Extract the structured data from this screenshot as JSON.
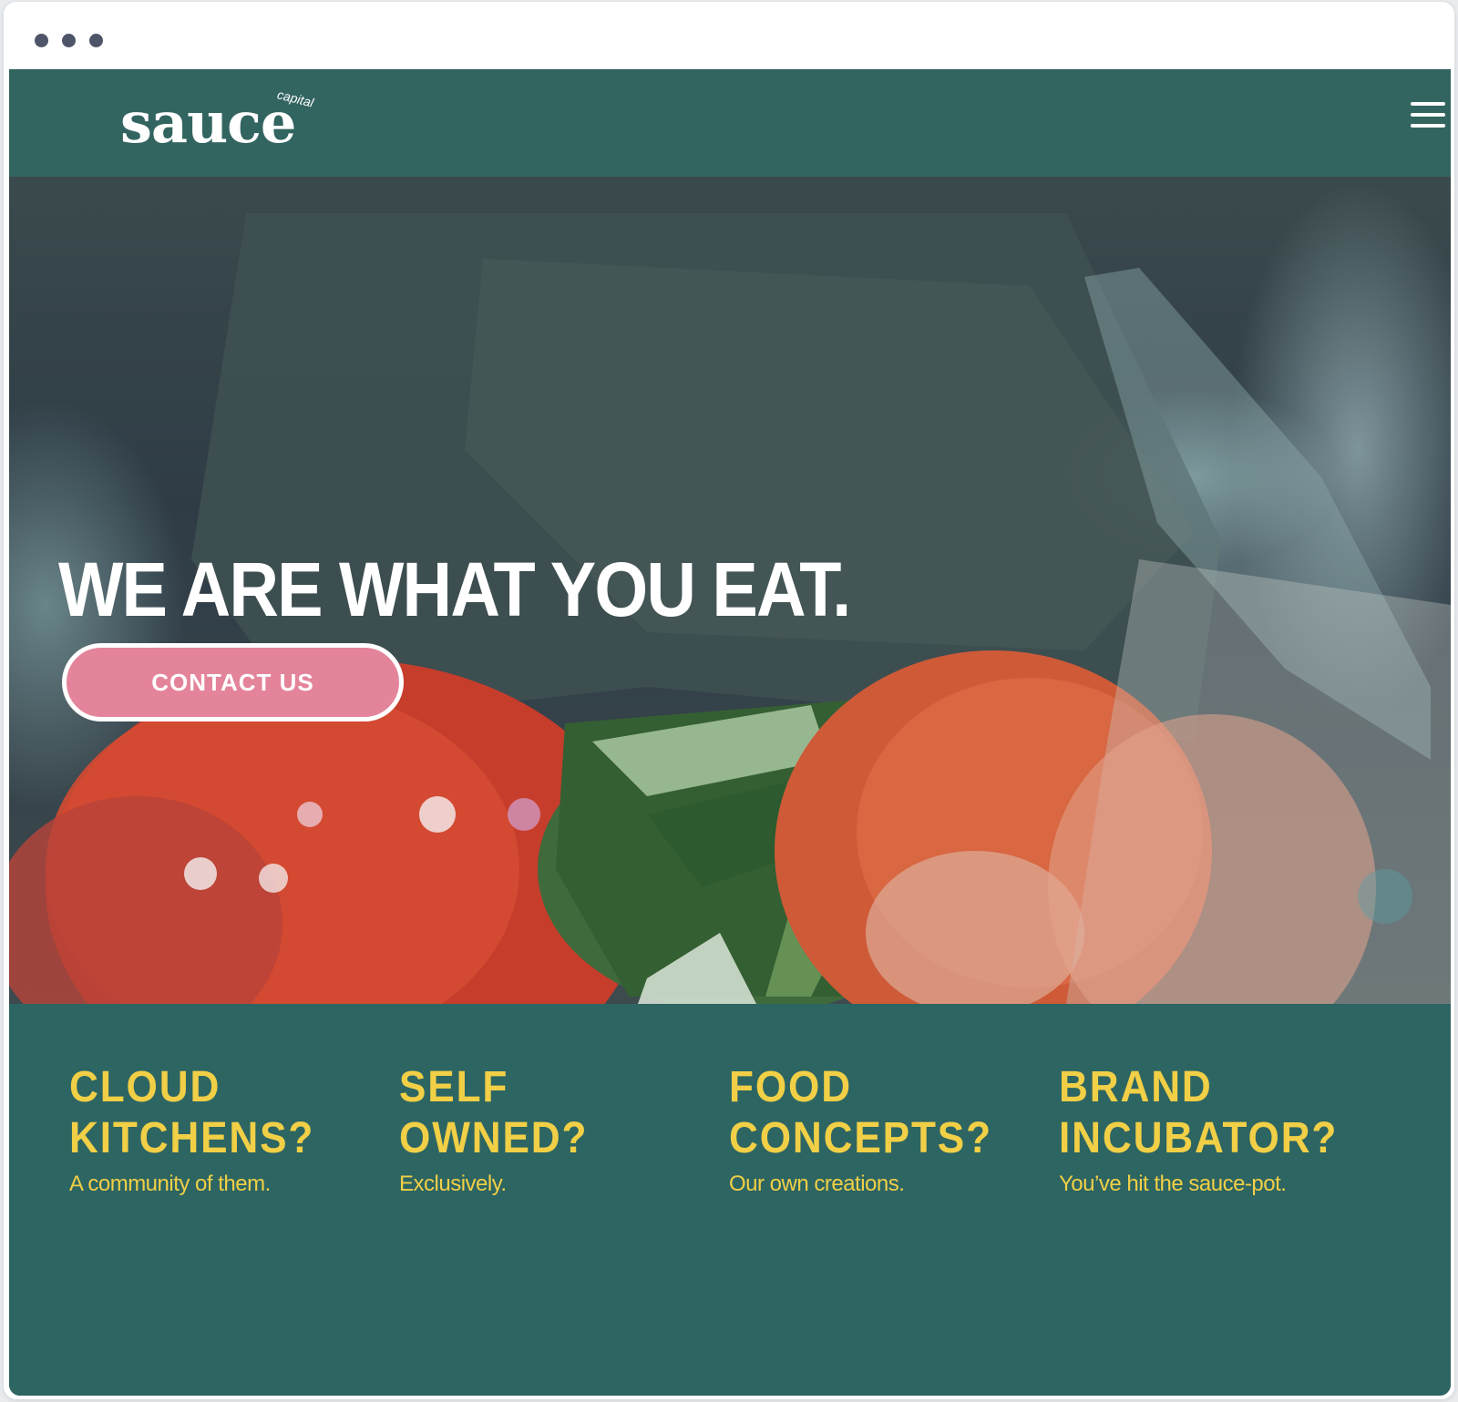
{
  "browser": {
    "window_controls": [
      "dot",
      "dot",
      "dot"
    ]
  },
  "header": {
    "logo_word": "sauce",
    "logo_sub": "capital",
    "menu_icon": "hamburger-menu-icon"
  },
  "hero": {
    "title": "WE ARE WHAT YOU EAT.",
    "cta_label": "CONTACT US"
  },
  "features": [
    {
      "line1": "CLOUD",
      "line2": "KITCHENS?",
      "caption": "A community of them."
    },
    {
      "line1": "SELF",
      "line2": "OWNED?",
      "caption": "Exclusively."
    },
    {
      "line1": "FOOD",
      "line2": "CONCEPTS?",
      "caption": "Our own creations."
    },
    {
      "line1": "BRAND",
      "line2": "INCUBATOR?",
      "caption": "You’ve hit the sauce-pot."
    }
  ],
  "colors": {
    "header_bg": "#326460",
    "section_bg": "#2d6562",
    "accent_yellow": "#f1cf46",
    "cta_pink": "#e4849a",
    "text_white": "#ffffff"
  }
}
